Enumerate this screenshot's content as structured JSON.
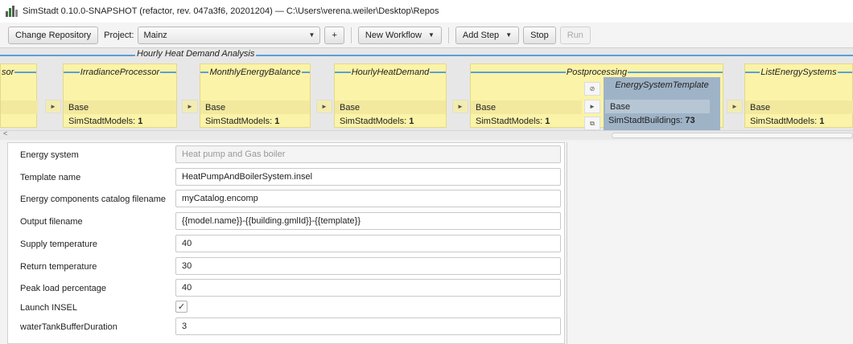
{
  "window": {
    "title": "SimStadt 0.10.0-SNAPSHOT (refactor, rev. 047a3f6, 20201204)  —  C:\\Users\\verena.weiler\\Desktop\\Repos"
  },
  "toolbar": {
    "change_repository": "Change Repository",
    "project_label": "Project:",
    "project_value": "Mainz",
    "add_label": "+",
    "new_workflow": "New Workflow",
    "add_step": "Add Step",
    "stop": "Stop",
    "run": "Run"
  },
  "workflow": {
    "group_title": "Hourly Heat Demand Analysis",
    "postprocessing_title": "Postprocessing",
    "partial_title": "sor",
    "steps": [
      {
        "title": "IrradianceProcessor",
        "base": "Base",
        "count_label": "SimStadtModels:",
        "count": "1"
      },
      {
        "title": "MonthlyEnergyBalance",
        "base": "Base",
        "count_label": "SimStadtModels:",
        "count": "1"
      },
      {
        "title": "HourlyHeatDemand",
        "base": "Base",
        "count_label": "SimStadtModels:",
        "count": "1"
      },
      {
        "title": "",
        "base": "Base",
        "count_label": "SimStadtModels:",
        "count": "1"
      },
      {
        "title": "ListEnergySystems",
        "base": "Base",
        "count_label": "SimStadtModels:",
        "count": "1"
      }
    ],
    "selected_step": {
      "title": "EnergySystemTemplate",
      "base": "Base",
      "count_label": "SimStadtBuildings:",
      "count": "73"
    },
    "icons": {
      "disable": "⊘",
      "arrow": "►",
      "copy": "⧉"
    }
  },
  "properties": [
    {
      "label": "Energy system",
      "value": "Heat pump and Gas boiler",
      "disabled": true
    },
    {
      "label": "Template name",
      "value": "HeatPumpAndBoilerSystem.insel"
    },
    {
      "label": "Energy components catalog filename",
      "value": "myCatalog.encomp"
    },
    {
      "label": "Output filename",
      "value": "{{model.name}}-{{building.gmlId}}-{{template}}"
    },
    {
      "label": "Supply temperature",
      "value": "40"
    },
    {
      "label": "Return temperature",
      "value": "30"
    },
    {
      "label": "Peak load percentage",
      "value": "40"
    },
    {
      "label": "Launch INSEL",
      "checked": true,
      "check_glyph": "✓"
    },
    {
      "label": "waterTankBufferDuration",
      "value": "3"
    }
  ]
}
